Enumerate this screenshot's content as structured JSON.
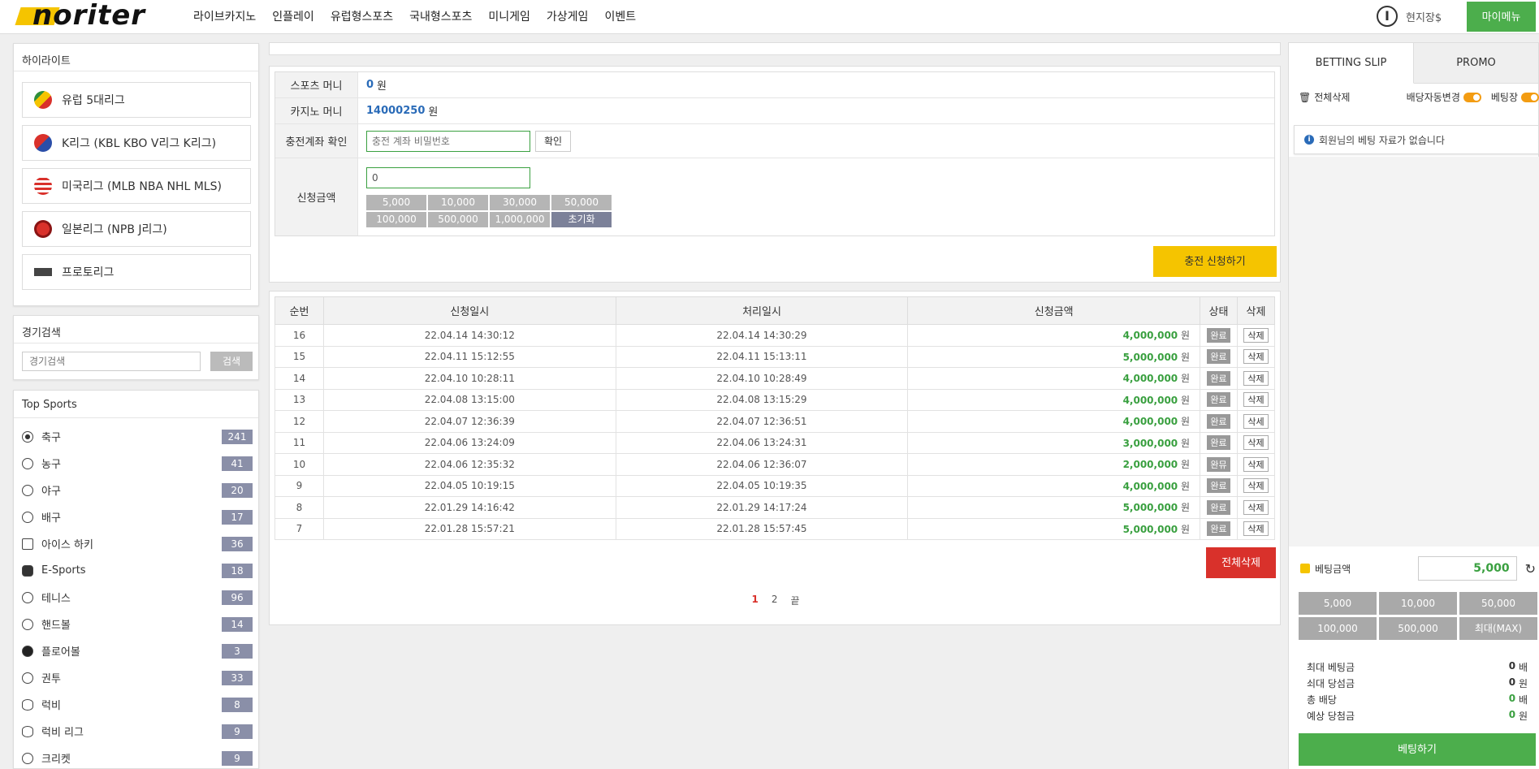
{
  "header": {
    "logo": "noriter",
    "nav": [
      "라이브카지노",
      "인플레이",
      "유럽형스포츠",
      "국내형스포츠",
      "미니게임",
      "가상게임",
      "이벤트"
    ],
    "user_label": "현지장$",
    "mymenu": "마이메뉴"
  },
  "highlight": {
    "title": "하이라이트",
    "items": [
      {
        "label": "유럽 5대리그",
        "icon": "soccer-league-icon"
      },
      {
        "label": "K리그 (KBL KBO V리그 K리그)",
        "icon": "k-league-icon"
      },
      {
        "label": "미국리그 (MLB NBA NHL MLS)",
        "icon": "us-league-icon"
      },
      {
        "label": "일본리그 (NPB J리그)",
        "icon": "japan-league-icon"
      },
      {
        "label": "프로토리그",
        "icon": "proto-icon"
      }
    ]
  },
  "search": {
    "title": "경기검색",
    "placeholder": "경기검색",
    "button": "검색"
  },
  "top_sports": {
    "title": "Top Sports",
    "items": [
      {
        "label": "축구",
        "count": "241"
      },
      {
        "label": "농구",
        "count": "41"
      },
      {
        "label": "야구",
        "count": "20"
      },
      {
        "label": "배구",
        "count": "17"
      },
      {
        "label": "아이스 하키",
        "count": "36"
      },
      {
        "label": "E-Sports",
        "count": "18"
      },
      {
        "label": "테니스",
        "count": "96"
      },
      {
        "label": "핸드볼",
        "count": "14"
      },
      {
        "label": "플로어볼",
        "count": "3"
      },
      {
        "label": "권투",
        "count": "33"
      },
      {
        "label": "럭비",
        "count": "8"
      },
      {
        "label": "럭비 리그",
        "count": "9"
      },
      {
        "label": "크리켓",
        "count": "9"
      }
    ]
  },
  "deposit_form": {
    "sports_money_label": "스포츠 머니",
    "sports_money": "0",
    "casino_money_label": "카지노 머니",
    "casino_money": "14000250",
    "unit": "원",
    "account_check_label": "충전계좌 확인",
    "account_placeholder": "충전 계좌 비밀번호",
    "confirm_button": "확인",
    "amount_label": "신청금액",
    "amount_value": "0",
    "amount_buttons": [
      "5,000",
      "10,000",
      "30,000",
      "50,000",
      "100,000",
      "500,000",
      "1,000,000",
      "초기화"
    ],
    "apply_button": "충전 신청하기"
  },
  "history": {
    "columns": [
      "순번",
      "신청일시",
      "처리일시",
      "신청금액",
      "상태",
      "삭제"
    ],
    "rows": [
      {
        "no": "16",
        "req": "22.04.14 14:30:12",
        "done": "22.04.14 14:30:29",
        "amount": "4,000,000",
        "status": "완료",
        "del": "삭제"
      },
      {
        "no": "15",
        "req": "22.04.11 15:12:55",
        "done": "22.04.11 15:13:11",
        "amount": "5,000,000",
        "status": "완료",
        "del": "삭제"
      },
      {
        "no": "14",
        "req": "22.04.10 10:28:11",
        "done": "22.04.10 10:28:49",
        "amount": "4,000,000",
        "status": "완료",
        "del": "삭제"
      },
      {
        "no": "13",
        "req": "22.04.08 13:15:00",
        "done": "22.04.08 13:15:29",
        "amount": "4,000,000",
        "status": "완료",
        "del": "삭제"
      },
      {
        "no": "12",
        "req": "22.04.07 12:36:39",
        "done": "22.04.07 12:36:51",
        "amount": "4,000,000",
        "status": "완료",
        "del": "삭세"
      },
      {
        "no": "11",
        "req": "22.04.06 13:24:09",
        "done": "22.04.06 13:24:31",
        "amount": "3,000,000",
        "status": "완료",
        "del": "삭제"
      },
      {
        "no": "10",
        "req": "22.04.06 12:35:32",
        "done": "22.04.06 12:36:07",
        "amount": "2,000,000",
        "status": "완뮤",
        "del": "삭제"
      },
      {
        "no": "9",
        "req": "22.04.05 10:19:15",
        "done": "22.04.05 10:19:35",
        "amount": "4,000,000",
        "status": "완료",
        "del": "삭제"
      },
      {
        "no": "8",
        "req": "22.01.29 14:16:42",
        "done": "22.01.29 14:17:24",
        "amount": "5,000,000",
        "status": "완료",
        "del": "삭제"
      },
      {
        "no": "7",
        "req": "22.01.28 15:57:21",
        "done": "22.01.28 15:57:45",
        "amount": "5,000,000",
        "status": "완료",
        "del": "삭제"
      }
    ],
    "unit": "원",
    "delete_all": "전체삭제",
    "pages": [
      "1",
      "2",
      "끝"
    ],
    "current_page": "1"
  },
  "slip": {
    "tabs": [
      "BETTING SLIP",
      "PROMO"
    ],
    "clear_all": "전체삭제",
    "auto_odds": "배당자동변경",
    "bet_window": "베팅장",
    "notice": "회원님의 베팅 자료가 없습니다",
    "bet_amount_label": "베팅금액",
    "bet_amount": "5,000",
    "quick": [
      "5,000",
      "10,000",
      "50,000",
      "100,000",
      "500,000",
      "최대(MAX)"
    ],
    "summary": [
      {
        "label": "최대 베팅금",
        "value": "0",
        "unit": "배"
      },
      {
        "label": "쇠대 당섬금",
        "value": "0",
        "unit": "원"
      },
      {
        "label": "총 배당",
        "value": "0",
        "unit": "배"
      },
      {
        "label": "예상 당첨금",
        "value": "0",
        "unit": "원"
      }
    ],
    "place_bet": "베팅하기"
  }
}
